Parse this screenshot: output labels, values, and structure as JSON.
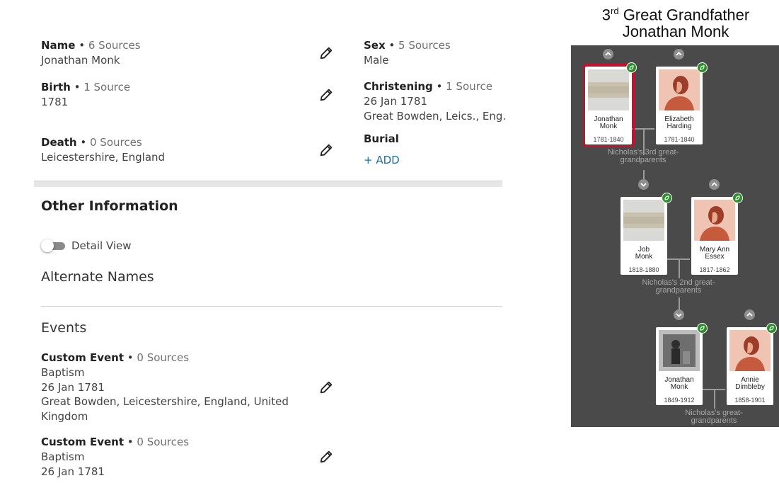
{
  "facts": {
    "name": {
      "label": "Name",
      "sources": "6 Sources",
      "value": "Jonathan Monk"
    },
    "birth": {
      "label": "Birth",
      "sources": "1 Source",
      "value": "1781"
    },
    "death": {
      "label": "Death",
      "sources": "0 Sources",
      "value": "Leicestershire, England"
    },
    "sex": {
      "label": "Sex",
      "sources": "5 Sources",
      "value": "Male"
    },
    "christening": {
      "label": "Christening",
      "sources": "1 Source",
      "date": "26 Jan 1781",
      "place": "Great Bowden, Leics., Eng."
    },
    "burial": {
      "label": "Burial",
      "add_label": "+  ADD"
    }
  },
  "other_info": {
    "title": "Other Information",
    "detail_view_label": "Detail View",
    "detail_view_on": false,
    "alternate_names_title": "Alternate Names",
    "events_title": "Events",
    "events": [
      {
        "label": "Custom Event",
        "sources": "0 Sources",
        "type": "Baptism",
        "date": "26 Jan 1781",
        "place_line1": "Great Bowden, Leicestershire, England, United",
        "place_line2": "Kingdom"
      },
      {
        "label": "Custom Event",
        "sources": "0 Sources",
        "type": "Baptism",
        "date": "26 Jan 1781"
      }
    ]
  },
  "tree": {
    "title_ordinal": "3",
    "title_suffix": "rd",
    "title_rest": " Great Grandfather",
    "title_name": "Jonathan Monk",
    "people": [
      {
        "first": "Jonathan",
        "last": "Monk",
        "years": "1781-1840"
      },
      {
        "first": "Elizabeth",
        "last": "Harding",
        "years": "1781-1840"
      },
      {
        "first": "Job",
        "last": "Monk",
        "years": "1818-1880"
      },
      {
        "first": "Mary Ann",
        "last": "Essex",
        "years": "1817-1862"
      },
      {
        "first": "Jonathan",
        "last": "Monk",
        "years": "1849-1912"
      },
      {
        "first": "Annie",
        "last": "Dimbleby",
        "years": "1858-1901"
      }
    ],
    "generations": [
      {
        "line1": "Nicholas's 3rd great-",
        "line2": "grandparents"
      },
      {
        "line1": "Nicholas's 2nd great-",
        "line2": "grandparents"
      },
      {
        "line1": "Nicholas's great-",
        "line2": "grandparents"
      }
    ],
    "colors": {
      "background": "#4a4a4a",
      "selected_outline": "#c8102e",
      "hint_leaf": "#2d8c2d",
      "woman_avatar": "#f0c4b2"
    }
  }
}
